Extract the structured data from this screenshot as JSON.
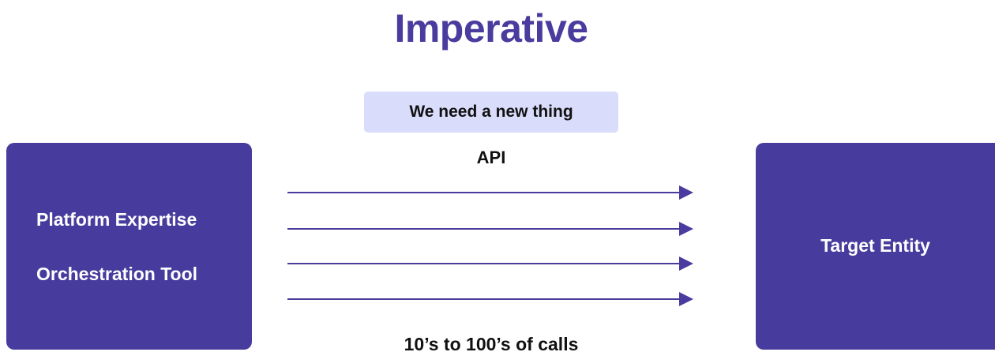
{
  "title": "Imperative",
  "request_label": "We need a new thing",
  "api_label": "API",
  "calls_label": "10’s to 100’s of calls",
  "source_box": {
    "lines": [
      "Platform Expertise",
      "Orchestration Tool"
    ]
  },
  "target_box": {
    "label": "Target Entity"
  },
  "arrows": {
    "count": 4,
    "direction": "right"
  },
  "colors": {
    "title": "#4a3c9e",
    "box_fill": "#473b9d",
    "request_fill": "#d9dcfb",
    "arrow": "#4a3c9e"
  }
}
